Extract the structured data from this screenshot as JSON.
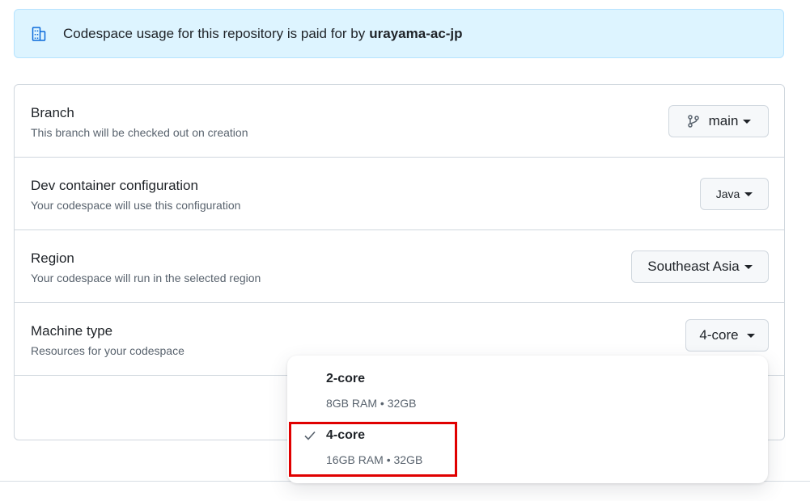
{
  "banner": {
    "text": "Codespace usage for this repository is paid for by",
    "org": "urayama-ac-jp",
    "icon": "organization-icon"
  },
  "settings": {
    "branch": {
      "title": "Branch",
      "description": "This branch will be checked out on creation",
      "value": "main",
      "icon": "git-branch-icon"
    },
    "devcontainer": {
      "title": "Dev container configuration",
      "description": "Your codespace will use this configuration",
      "value": "Java"
    },
    "region": {
      "title": "Region",
      "description": "Your codespace will run in the selected region",
      "value": "Southeast Asia"
    },
    "machine": {
      "title": "Machine type",
      "description": "Resources for your codespace",
      "value": "4-core"
    }
  },
  "machine_menu": {
    "options": [
      {
        "label": "2-core",
        "specs": "8GB RAM • 32GB",
        "selected": false
      },
      {
        "label": "4-core",
        "specs": "16GB RAM • 32GB",
        "selected": true
      }
    ]
  },
  "colors": {
    "banner_bg": "#ddf4ff",
    "border": "#d0d7de",
    "highlight": "#e00000"
  }
}
